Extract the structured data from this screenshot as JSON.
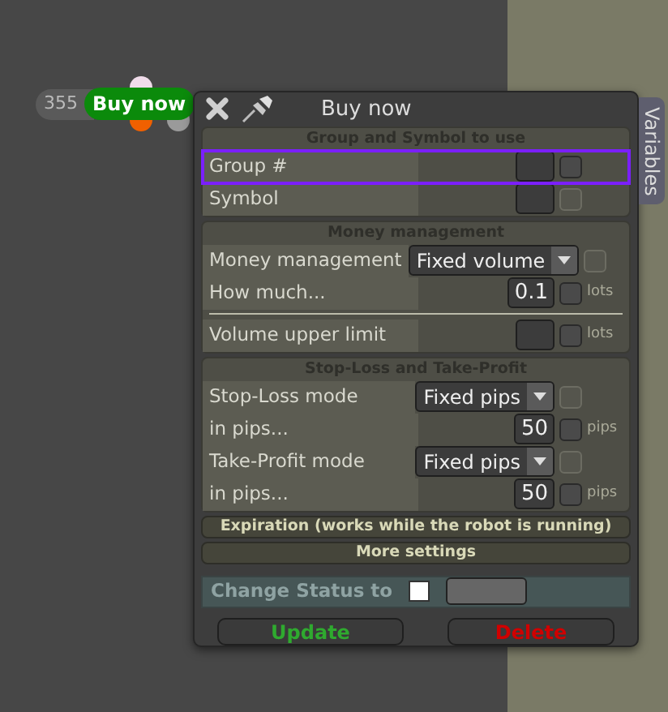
{
  "node": {
    "count": "355",
    "label": "Buy now"
  },
  "dialog": {
    "title": "Buy now",
    "side_tab": "Variables"
  },
  "sections": [
    {
      "title": "Group and Symbol to use",
      "expanded": true,
      "rows": [
        {
          "kind": "text",
          "label": "Group #",
          "highlighted": true,
          "checkbox": {
            "checked": false,
            "disabled": false
          }
        },
        {
          "kind": "text",
          "label": "Symbol",
          "highlighted": false,
          "checkbox": {
            "checked": false,
            "disabled": true
          }
        }
      ]
    },
    {
      "title": "Money management",
      "expanded": true,
      "rows": [
        {
          "kind": "select",
          "label": "Money management",
          "value": "Fixed volume",
          "highlighted": false,
          "checkbox": {
            "checked": false,
            "disabled": true
          }
        },
        {
          "kind": "number",
          "label": "How much...",
          "value": "0.1",
          "unit": "lots",
          "highlighted": false,
          "checkbox": {
            "checked": false,
            "disabled": false
          }
        },
        {
          "kind": "divider"
        },
        {
          "kind": "number",
          "label": "Volume upper limit",
          "unit": "lots",
          "highlighted": false,
          "checkbox": {
            "checked": false,
            "disabled": false
          }
        }
      ]
    },
    {
      "title": "Stop-Loss and Take-Profit",
      "expanded": true,
      "rows": [
        {
          "kind": "select",
          "label": "Stop-Loss mode",
          "value": "Fixed pips",
          "highlighted": false,
          "checkbox": {
            "checked": false,
            "disabled": true
          }
        },
        {
          "kind": "number",
          "label": "in pips...",
          "value": "50",
          "unit": "pips",
          "highlighted": false,
          "checkbox": {
            "checked": false,
            "disabled": false
          }
        },
        {
          "kind": "select",
          "label": "Take-Profit mode",
          "value": "Fixed pips",
          "highlighted": false,
          "checkbox": {
            "checked": false,
            "disabled": true
          }
        },
        {
          "kind": "number",
          "label": "in pips...",
          "value": "50",
          "unit": "pips",
          "highlighted": false,
          "checkbox": {
            "checked": false,
            "disabled": false
          }
        }
      ]
    },
    {
      "title": "Expiration (works while the robot is running)",
      "expanded": false
    },
    {
      "title": "More settings",
      "expanded": false
    }
  ],
  "status": {
    "label": "Change Status to",
    "checked": false
  },
  "buttons": [
    {
      "kind": "confirm",
      "label": "Update"
    },
    {
      "kind": "danger",
      "label": "Delete"
    }
  ]
}
